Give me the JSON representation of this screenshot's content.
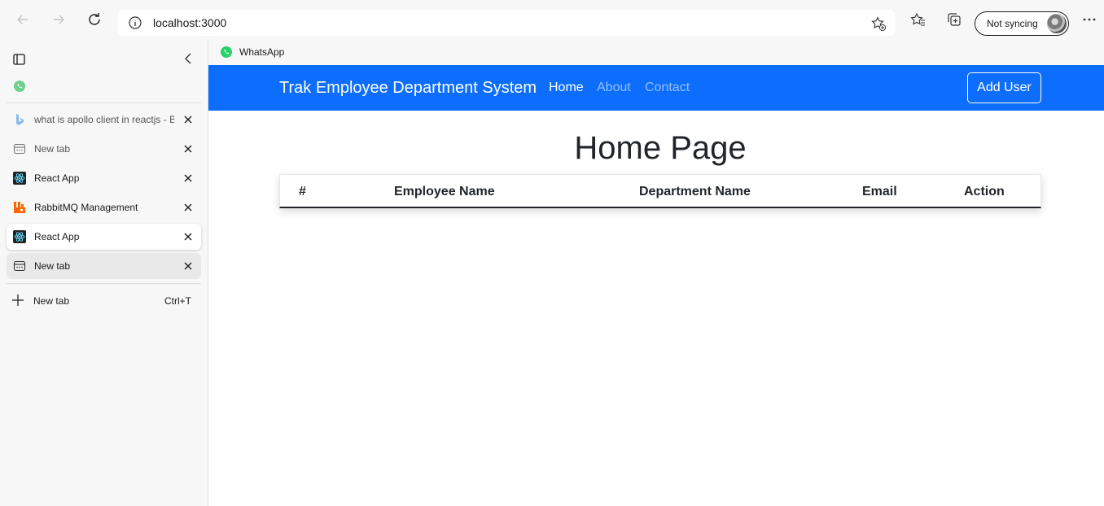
{
  "browser": {
    "url": "localhost:3000",
    "sync_label": "Not syncing"
  },
  "sidebar": {
    "tabs": [
      {
        "title": "what is apollo client in reactjs - Bing",
        "icon": "bing-icon"
      },
      {
        "title": "New tab",
        "icon": "new-tab-icon"
      },
      {
        "title": "React App",
        "icon": "react-icon"
      },
      {
        "title": "RabbitMQ Management",
        "icon": "rabbitmq-icon"
      },
      {
        "title": "React App",
        "icon": "react-icon"
      },
      {
        "title": "New tab",
        "icon": "new-tab-icon"
      }
    ],
    "new_tab_label": "New tab",
    "new_tab_shortcut": "Ctrl+T"
  },
  "favorites": {
    "items": [
      {
        "label": "WhatsApp",
        "icon": "whatsapp-icon"
      }
    ]
  },
  "app": {
    "brand": "Trak Employee Department System",
    "nav": {
      "home": "Home",
      "about": "About",
      "contact": "Contact"
    },
    "add_user_label": "Add User",
    "page_title": "Home Page",
    "table": {
      "headers": [
        "#",
        "Employee Name",
        "Department Name",
        "Email",
        "Action"
      ]
    }
  },
  "colors": {
    "navbar": "#0d6efd",
    "chrome": "#f7f7f7"
  }
}
